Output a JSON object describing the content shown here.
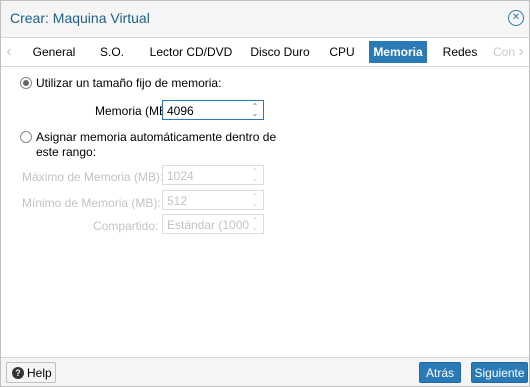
{
  "window": {
    "title": "Crear: Maquina Virtual"
  },
  "tabs": [
    {
      "label": "General"
    },
    {
      "label": "S.O."
    },
    {
      "label": "Lector CD/DVD"
    },
    {
      "label": "Disco Duro"
    },
    {
      "label": "CPU"
    },
    {
      "label": "Memoria",
      "active": true
    },
    {
      "label": "Redes"
    },
    {
      "label": "Con"
    }
  ],
  "memory": {
    "fixed_option_label": "Utilizar un tamaño fijo de memoria:",
    "memory_label": "Memoria (MB):",
    "memory_value": "4096",
    "auto_option_label_line1": "Asignar memoria automáticamente dentro de",
    "auto_option_label_line2": "este rango:",
    "max_label": "Máximo de Memoria (MB):",
    "max_value": "1024",
    "min_label": "Mínimo de Memoria (MB):",
    "min_value": "512",
    "shares_label": "Compartido:",
    "shares_value": "Estándar (1000"
  },
  "footer": {
    "help_label": "Help",
    "back_label": "Atrás",
    "next_label": "Siguiente"
  },
  "colors": {
    "accent": "#2a7ab8",
    "title": "#1f5f8a",
    "disabled_text": "#c3c3c3"
  },
  "icons": {
    "close": "close-circle-icon",
    "help": "question-circle-icon",
    "scroll_left": "chevron-left-icon",
    "scroll_right": "chevron-right-icon"
  }
}
